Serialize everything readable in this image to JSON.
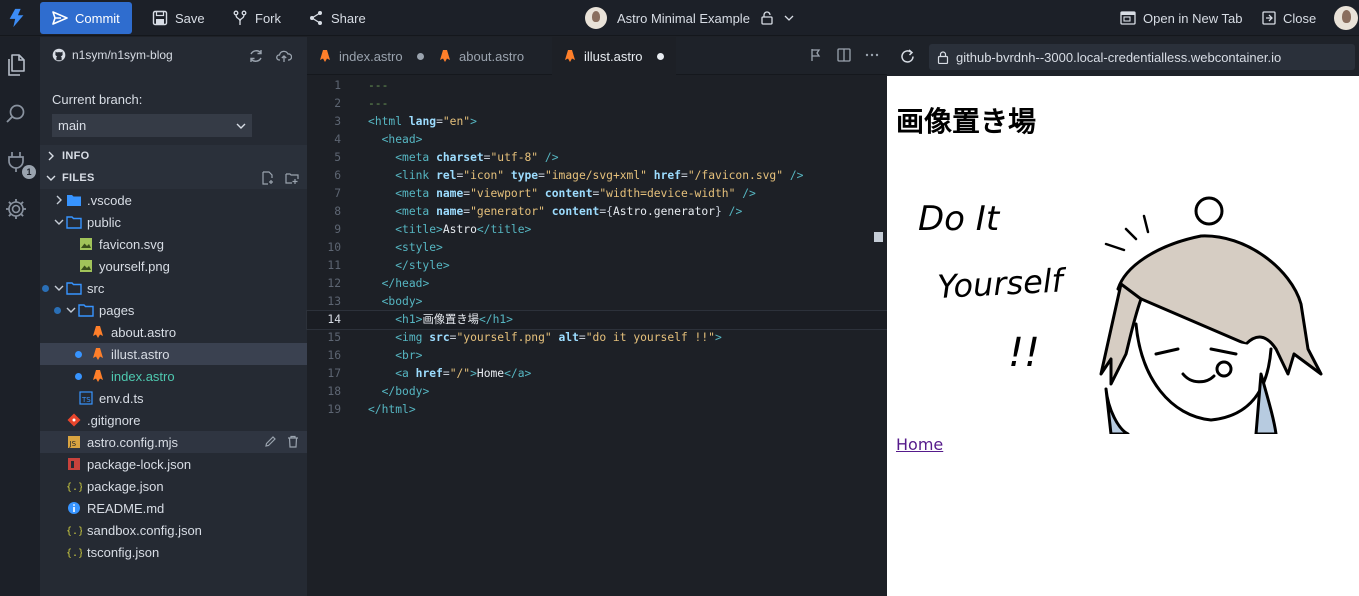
{
  "topbar": {
    "commit_label": "Commit",
    "save_label": "Save",
    "fork_label": "Fork",
    "share_label": "Share",
    "project_title": "Astro Minimal Example",
    "open_new_tab_label": "Open in New Tab",
    "close_label": "Close"
  },
  "activity_bar": {
    "icons": [
      "explorer-icon",
      "search-icon",
      "extensions-icon",
      "settings-icon"
    ],
    "extensions_badge": "1"
  },
  "sidebar": {
    "repo": "n1sym/n1sym-blog",
    "branch_label": "Current branch:",
    "branch_value": "main",
    "info_header": "INFO",
    "files_header": "FILES",
    "tree": [
      {
        "label": ".vscode",
        "type": "folder",
        "depth": 1,
        "expanded": false
      },
      {
        "label": "public",
        "type": "folder",
        "depth": 1,
        "expanded": true
      },
      {
        "label": "favicon.svg",
        "type": "image",
        "depth": 2
      },
      {
        "label": "yourself.png",
        "type": "image",
        "depth": 2
      },
      {
        "label": "src",
        "type": "folder",
        "depth": 1,
        "expanded": true,
        "modified": true
      },
      {
        "label": "pages",
        "type": "folder",
        "depth": 2,
        "expanded": true,
        "modified": true
      },
      {
        "label": "about.astro",
        "type": "astro",
        "depth": 3
      },
      {
        "label": "illust.astro",
        "type": "astro",
        "depth": 3,
        "modified": true,
        "selected": true
      },
      {
        "label": "index.astro",
        "type": "astro",
        "depth": 3,
        "modified": true,
        "status": "added"
      },
      {
        "label": "env.d.ts",
        "type": "ts",
        "depth": 2
      },
      {
        "label": ".gitignore",
        "type": "git",
        "depth": 1
      },
      {
        "label": "astro.config.mjs",
        "type": "js",
        "depth": 1,
        "hovered": true
      },
      {
        "label": "package-lock.json",
        "type": "npm",
        "depth": 1
      },
      {
        "label": "package.json",
        "type": "json",
        "depth": 1
      },
      {
        "label": "README.md",
        "type": "info",
        "depth": 1
      },
      {
        "label": "sandbox.config.json",
        "type": "json",
        "depth": 1
      },
      {
        "label": "tsconfig.json",
        "type": "json",
        "depth": 1
      }
    ]
  },
  "editor": {
    "tabs": [
      {
        "label": "index.astro",
        "modified": true,
        "active": false
      },
      {
        "label": "about.astro",
        "modified": false,
        "active": false
      },
      {
        "label": "illust.astro",
        "modified": true,
        "active": true
      }
    ],
    "current_line": 14,
    "lines": [
      "---",
      "---",
      "<html lang=\"en\">",
      "  <head>",
      "    <meta charset=\"utf-8\" />",
      "    <link rel=\"icon\" type=\"image/svg+xml\" href=\"/favicon.svg\" />",
      "    <meta name=\"viewport\" content=\"width=device-width\" />",
      "    <meta name=\"generator\" content={Astro.generator} />",
      "    <title>Astro</title>",
      "    <style>",
      "    </style>",
      "  </head>",
      "  <body>",
      "    <h1>画像置き場</h1>",
      "    <img src=\"yourself.png\" alt=\"do it yourself !!\">",
      "    <br>",
      "    <a href=\"/\">Home</a>",
      "  </body>",
      "</html>"
    ]
  },
  "preview": {
    "url": "github-bvrdnh--3000.local-credentialless.webcontainer.io",
    "heading": "画像置き場",
    "image_alt": "do it yourself !!",
    "image_text_lines": [
      "Do It",
      "Yourself",
      "!!"
    ],
    "link_label": "Home"
  },
  "colors": {
    "accent": "#2f6dcf",
    "modified_dot": "#3794ff",
    "astro_orange": "#ff7f2a",
    "added_green": "#4ec9b0"
  }
}
